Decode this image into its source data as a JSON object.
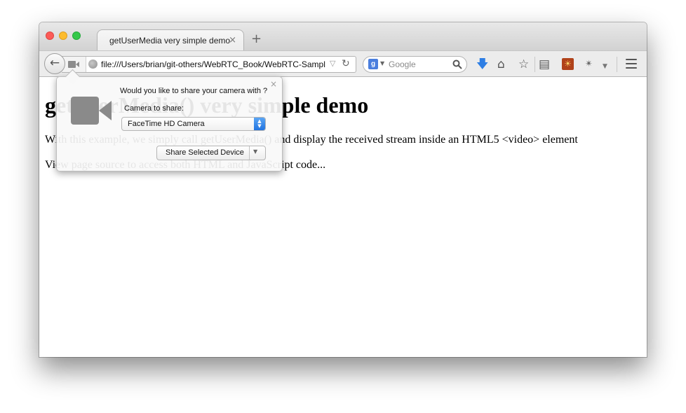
{
  "browser": {
    "tab": {
      "title": "getUserMedia very simple demo",
      "close_glyph": "×"
    },
    "new_tab_glyph": "+",
    "url": "file:///Users/brian/git-others/WebRTC_Book/WebRTC-Sampl",
    "search": {
      "engine_label": "g",
      "placeholder": "Google"
    },
    "toolbar_icons": [
      "download-icon",
      "home-icon",
      "star-icon",
      "reading-list-icon",
      "extension-icon",
      "extension-icon-2",
      "menu-icon"
    ]
  },
  "page": {
    "heading": "getUserMedia() very simple demo",
    "para1": "With this example, we simply call getUserMedia() and display the received stream inside an HTML5 <video> element",
    "para2": "View page source to access both HTML and JavaScript code..."
  },
  "doorhanger": {
    "question": "Would you like to share your camera with ?",
    "camera_label": "Camera to share:",
    "selected_camera": "FaceTime HD Camera",
    "share_button": "Share Selected Device",
    "close_glyph": "×"
  }
}
